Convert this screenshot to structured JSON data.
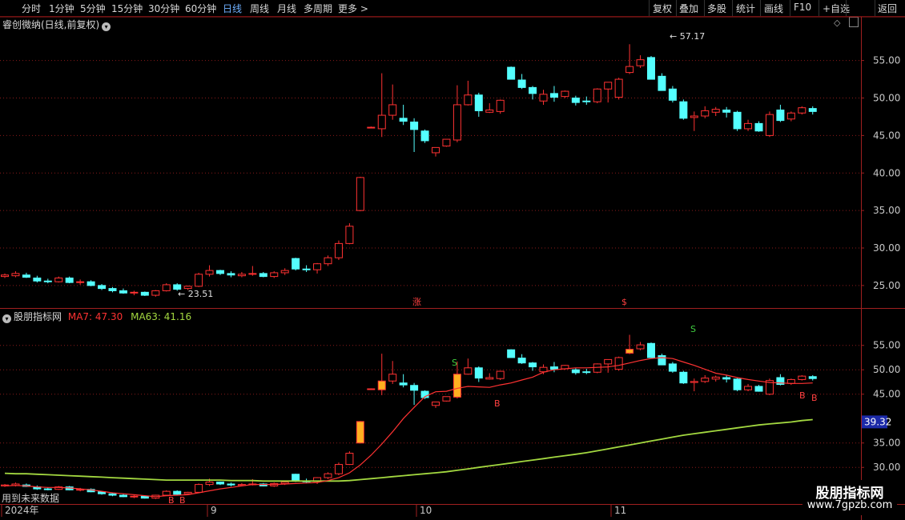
{
  "toolbar": {
    "periods": [
      "分时",
      "1分钟",
      "5分钟",
      "15分钟",
      "30分钟",
      "60分钟",
      "日线",
      "周线",
      "月线",
      "多周期",
      "更多 >"
    ],
    "active_period": "日线",
    "tools": [
      "复权",
      "叠加",
      "多股",
      "统计",
      "画线",
      "F10",
      "+自选",
      "返回"
    ]
  },
  "main_panel": {
    "title": "睿创微纳(日线,前复权)",
    "y_ticks": [
      "55.00",
      "50.00",
      "45.00",
      "40.00",
      "35.00",
      "30.00",
      "25.00"
    ],
    "high_label": "57.17",
    "low_label": "23.51",
    "markers": [
      "涨",
      "$"
    ]
  },
  "sub_panel": {
    "title": "股朋指标网",
    "ma7_label": "MA7: 47.30",
    "ma63_label": "MA63: 41.16",
    "y_ticks": [
      "55.00",
      "50.00",
      "45.00",
      "35.00",
      "30.00"
    ],
    "current_value": "39.32",
    "signal_s": "S",
    "signal_b": "B"
  },
  "x_axis": {
    "labels": [
      "2024年",
      "9",
      "10",
      "11"
    ]
  },
  "bottom_note": "用到未来数据",
  "watermark": {
    "line1": "股朋指标网",
    "line2": "www.7gpzb.com"
  },
  "colors": {
    "up": "#ff3232",
    "down": "#54ffff",
    "ma7": "#ff3232",
    "ma63": "#a3d840",
    "grid": "#8a1a1a",
    "axis": "#a02020"
  },
  "chart_data": {
    "type": "candlestick",
    "ohlc": [
      [
        26.2,
        26.6,
        26.0,
        26.4
      ],
      [
        26.3,
        26.9,
        26.1,
        26.6
      ],
      [
        26.4,
        26.7,
        26.0,
        26.1
      ],
      [
        26.0,
        26.3,
        25.4,
        25.6
      ],
      [
        25.6,
        25.9,
        25.3,
        25.5
      ],
      [
        25.5,
        26.2,
        25.4,
        26.0
      ],
      [
        26.0,
        26.2,
        25.3,
        25.4
      ],
      [
        25.4,
        25.8,
        25.1,
        25.5
      ],
      [
        25.5,
        25.7,
        24.9,
        25.0
      ],
      [
        25.0,
        25.2,
        24.4,
        24.6
      ],
      [
        24.6,
        24.8,
        24.1,
        24.3
      ],
      [
        24.3,
        24.6,
        23.9,
        24.0
      ],
      [
        24.0,
        24.3,
        23.7,
        24.1
      ],
      [
        24.1,
        24.2,
        23.6,
        23.7
      ],
      [
        23.7,
        24.4,
        23.51,
        24.3
      ],
      [
        24.3,
        25.3,
        24.2,
        25.1
      ],
      [
        25.1,
        25.3,
        24.3,
        24.5
      ],
      [
        24.6,
        25.0,
        24.4,
        24.9
      ],
      [
        24.9,
        26.7,
        24.8,
        26.5
      ],
      [
        26.5,
        27.7,
        26.2,
        27.0
      ],
      [
        27.0,
        27.1,
        26.4,
        26.6
      ],
      [
        26.6,
        26.9,
        26.1,
        26.4
      ],
      [
        26.3,
        26.8,
        26.1,
        26.5
      ],
      [
        26.5,
        27.6,
        26.3,
        26.6
      ],
      [
        26.6,
        26.8,
        26.1,
        26.2
      ],
      [
        26.2,
        26.9,
        26.0,
        26.7
      ],
      [
        26.7,
        27.3,
        26.4,
        27.0
      ],
      [
        28.6,
        28.7,
        27.0,
        27.2
      ],
      [
        27.2,
        27.7,
        26.8,
        27.1
      ],
      [
        27.1,
        28.0,
        26.6,
        27.9
      ],
      [
        27.9,
        29.0,
        27.6,
        28.7
      ],
      [
        28.7,
        31.0,
        28.4,
        30.6
      ],
      [
        30.6,
        33.3,
        30.5,
        32.9
      ],
      [
        35.0,
        39.5,
        34.9,
        39.4
      ],
      [
        46.0,
        46.2,
        46.0,
        46.1
      ],
      [
        45.9,
        53.3,
        44.8,
        47.7
      ],
      [
        47.7,
        51.8,
        47.1,
        49.1
      ],
      [
        47.3,
        49.1,
        46.4,
        46.9
      ],
      [
        46.8,
        47.3,
        42.8,
        45.8
      ],
      [
        45.6,
        45.8,
        44.0,
        44.3
      ],
      [
        42.7,
        43.4,
        42.2,
        43.4
      ],
      [
        43.6,
        44.4,
        43.5,
        44.5
      ],
      [
        44.4,
        51.7,
        44.1,
        49.1
      ],
      [
        49.1,
        52.3,
        49.0,
        50.4
      ],
      [
        50.4,
        50.7,
        47.5,
        48.3
      ],
      [
        48.1,
        49.3,
        48.0,
        48.4
      ],
      [
        48.2,
        49.8,
        47.9,
        49.7
      ],
      [
        54.1,
        54.2,
        53.8,
        52.5
      ],
      [
        52.4,
        53.2,
        51.2,
        51.4
      ],
      [
        51.4,
        51.6,
        49.8,
        50.6
      ],
      [
        49.6,
        51.1,
        49.1,
        50.5
      ],
      [
        50.6,
        51.6,
        49.5,
        50.1
      ],
      [
        50.2,
        51.0,
        50.0,
        50.9
      ],
      [
        50.0,
        50.3,
        49.0,
        49.4
      ],
      [
        49.6,
        50.2,
        49.1,
        49.5
      ],
      [
        49.5,
        51.3,
        49.3,
        51.2
      ],
      [
        51.2,
        52.0,
        49.4,
        52.1
      ],
      [
        50.1,
        52.7,
        49.8,
        52.5
      ],
      [
        53.4,
        57.17,
        53.2,
        54.2
      ],
      [
        54.3,
        55.7,
        54.0,
        55.1
      ],
      [
        55.4,
        55.6,
        52.5,
        52.5
      ],
      [
        52.9,
        53.3,
        51.1,
        51.0
      ],
      [
        51.2,
        51.6,
        49.4,
        49.7
      ],
      [
        49.5,
        49.8,
        47.1,
        47.3
      ],
      [
        47.4,
        48.2,
        45.6,
        47.6
      ],
      [
        47.6,
        48.9,
        47.3,
        48.3
      ],
      [
        48.1,
        48.8,
        47.6,
        48.5
      ],
      [
        48.4,
        48.8,
        47.4,
        48.1
      ],
      [
        48.1,
        48.3,
        45.6,
        45.9
      ],
      [
        45.9,
        47.1,
        45.6,
        46.6
      ],
      [
        46.6,
        46.9,
        45.5,
        45.6
      ],
      [
        45.0,
        48.2,
        44.8,
        47.8
      ],
      [
        48.4,
        49.1,
        46.8,
        47.0
      ],
      [
        47.2,
        48.2,
        46.9,
        48.0
      ],
      [
        48.0,
        48.9,
        47.8,
        48.7
      ],
      [
        48.6,
        48.9,
        47.8,
        48.2
      ]
    ],
    "ma7": [
      26.2,
      26.3,
      26.2,
      26.0,
      25.9,
      25.9,
      25.8,
      25.6,
      25.4,
      25.1,
      24.8,
      24.6,
      24.4,
      24.2,
      24.0,
      24.2,
      24.3,
      24.4,
      24.8,
      25.2,
      25.6,
      25.9,
      26.2,
      26.5,
      26.5,
      26.5,
      26.6,
      26.7,
      26.8,
      26.9,
      27.3,
      27.9,
      28.9,
      30.5,
      32.5,
      34.8,
      37.3,
      40.0,
      42.3,
      44.5,
      45.5,
      45.6,
      46.2,
      46.6,
      46.5,
      46.4,
      46.9,
      47.3,
      47.9,
      48.5,
      49.5,
      50.0,
      50.2,
      50.4,
      50.4,
      50.5,
      50.6,
      50.9,
      51.4,
      51.9,
      52.3,
      52.5,
      52.3,
      51.6,
      50.9,
      50.1,
      49.3,
      48.9,
      48.4,
      48.0,
      47.7,
      47.4,
      47.3,
      47.2,
      47.2,
      47.3
    ],
    "ma63": [
      28.8,
      28.7,
      28.7,
      28.6,
      28.5,
      28.4,
      28.3,
      28.2,
      28.1,
      28.0,
      27.9,
      27.8,
      27.7,
      27.6,
      27.5,
      27.4,
      27.4,
      27.4,
      27.4,
      27.4,
      27.4,
      27.3,
      27.3,
      27.3,
      27.2,
      27.2,
      27.2,
      27.2,
      27.2,
      27.2,
      27.2,
      27.2,
      27.3,
      27.5,
      27.7,
      27.9,
      28.1,
      28.3,
      28.5,
      28.7,
      28.9,
      29.1,
      29.4,
      29.7,
      30.0,
      30.3,
      30.6,
      30.9,
      31.2,
      31.5,
      31.8,
      32.1,
      32.4,
      32.7,
      33.0,
      33.4,
      33.8,
      34.2,
      34.6,
      35.0,
      35.4,
      35.8,
      36.2,
      36.6,
      36.9,
      37.2,
      37.5,
      37.8,
      38.1,
      38.4,
      38.7,
      38.9,
      39.1,
      39.3,
      39.6,
      39.8
    ],
    "y_range_main": [
      22.0,
      58.8
    ],
    "y_range_sub": [
      22.5,
      60.2
    ],
    "x_labels": [
      "2024年",
      "9",
      "10",
      "11"
    ]
  }
}
